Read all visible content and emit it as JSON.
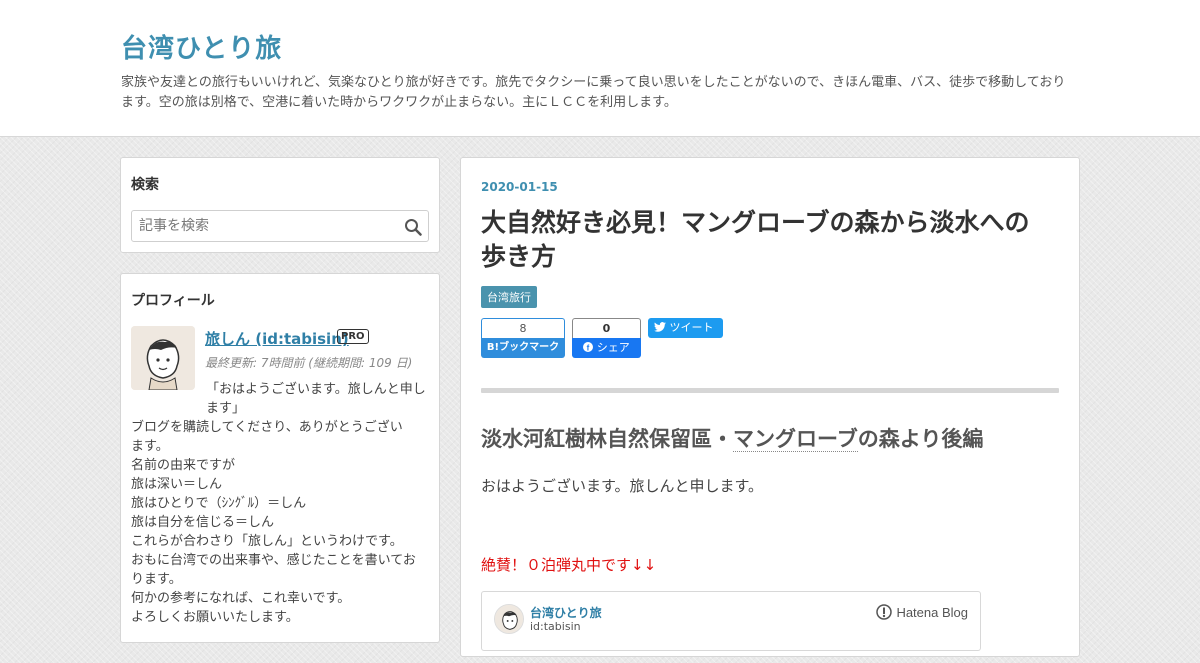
{
  "header": {
    "blog_title": "台湾ひとり旅",
    "description": "家族や友達との旅行もいいけれど、気楽なひとり旅が好きです。旅先でタクシーに乗って良い思いをしたことがないので、きほん電車、バス、徒歩で移動しております。空の旅は別格で、空港に着いた時からワクワクが止まらない。主にＬＣＣを利用します。"
  },
  "sidebar": {
    "search": {
      "title": "検索",
      "placeholder": "記事を検索"
    },
    "profile": {
      "title": "プロフィール",
      "name": "旅しん (id:tabisin)",
      "badge": "PRO",
      "updated": "最終更新: 7時間前 (継続期間: 109 日)",
      "greeting": "「おはようございます。旅しんと申します」",
      "lines": [
        "ブログを購読してくださり、ありがとうござい",
        "ます。",
        "名前の由来ですが",
        "旅は深い＝しん",
        "旅はひとりで（ｼﾝｸﾞﾙ）＝しん",
        "旅は自分を信じる＝しん",
        "これらが合わさり「旅しん」というわけです。",
        "おもに台湾での出来事や、感じたことを書いてお",
        "ります。",
        "何かの参考になれば、これ幸いです。",
        "よろしくお願いいたします。"
      ]
    }
  },
  "entry": {
    "date": "2020-01-15",
    "title": "大自然好き必見！マングローブの森から淡水への歩き方",
    "category": "台湾旅行",
    "share": {
      "hatena_count": "8",
      "hatena_label": "B!ブックマーク",
      "facebook_count": "0",
      "facebook_label": "シェア",
      "twitter_label": "ツイート"
    },
    "heading_prefix": "淡水河紅樹林自然保留區・",
    "heading_keyword": "マングローブ",
    "heading_suffix": "の森より後編",
    "paragraph": "おはようございます。旅しんと申します。",
    "alert": "絶賛！０泊弾丸中です↓↓",
    "embed": {
      "title": "台湾ひとり旅",
      "id": "id:tabisin",
      "logo_text": "Hatena Blog"
    }
  },
  "colors": {
    "accent": "#3f8fb0",
    "category_bg": "#4a93ad",
    "alert": "#e01010",
    "hatena_blue": "#2f8ddc",
    "facebook_blue": "#1877f2",
    "twitter_blue": "#1d9bf0"
  }
}
